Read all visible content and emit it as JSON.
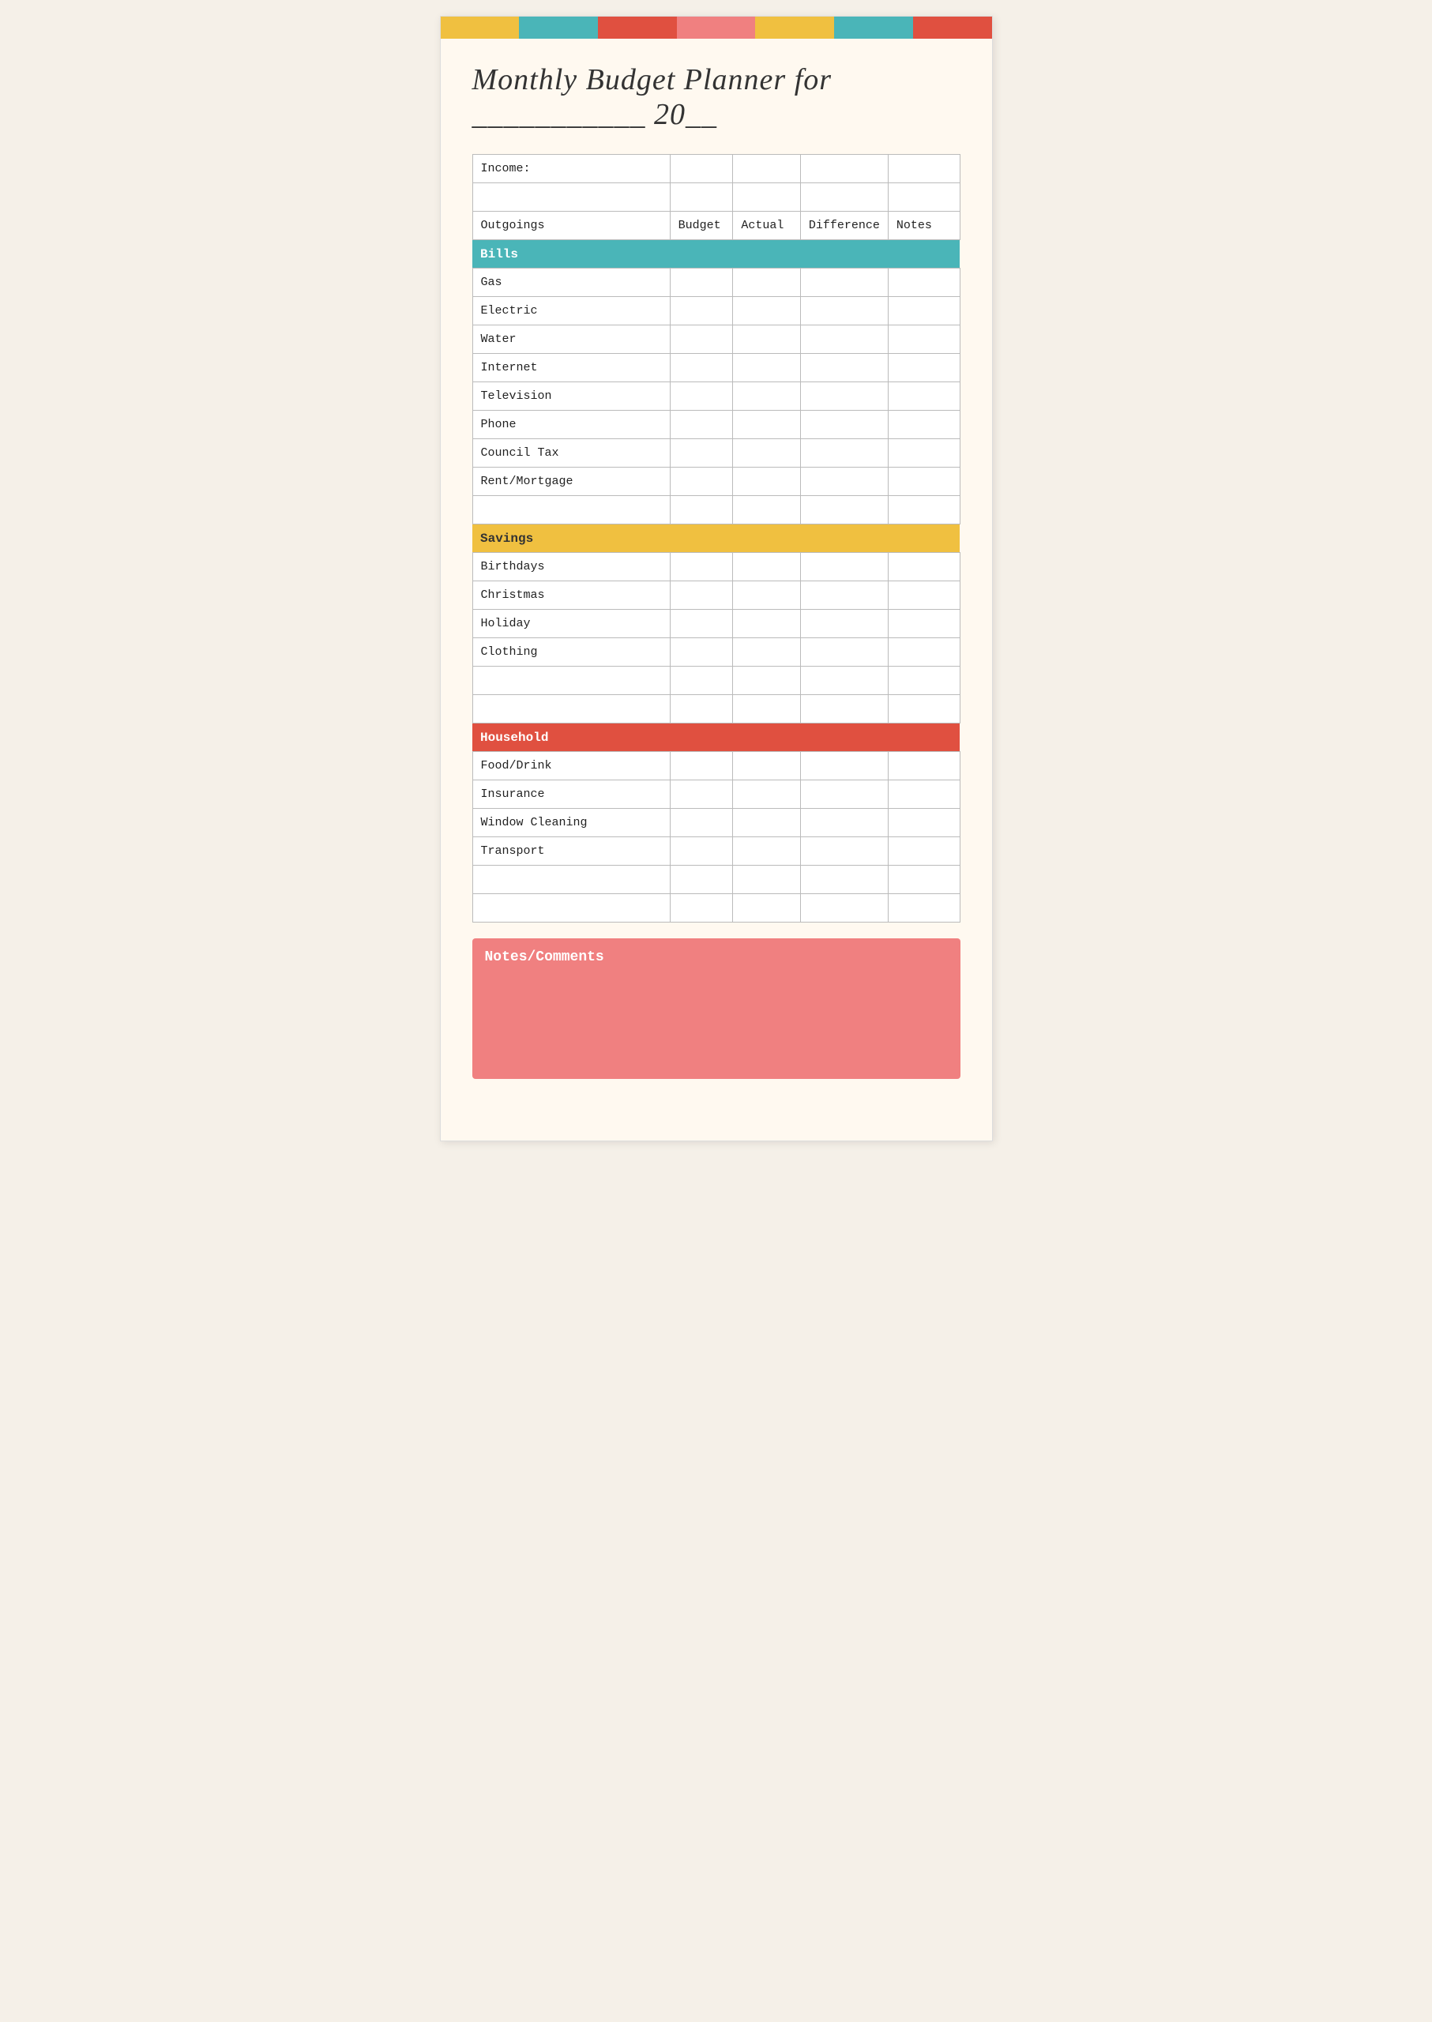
{
  "page": {
    "title_prefix": "Monthly Budget Planner for",
    "title_suffix": "20",
    "table": {
      "income_label": "Income:",
      "headers": {
        "outgoings": "Outgoings",
        "budget": "Budget",
        "actual": "Actual",
        "difference": "Difference",
        "notes": "Notes"
      },
      "sections": [
        {
          "id": "bills",
          "label": "Bills",
          "color_class": "cat-bills",
          "items": [
            "Gas",
            "Electric",
            "Water",
            "Internet",
            "Television",
            "Phone",
            "Council Tax",
            "Rent/Mortgage"
          ]
        },
        {
          "id": "savings",
          "label": "Savings",
          "color_class": "cat-savings",
          "items": [
            "Birthdays",
            "Christmas",
            "Holiday",
            "Clothing"
          ]
        },
        {
          "id": "household",
          "label": "Household",
          "color_class": "cat-household",
          "items": [
            "Food/Drink",
            "Insurance",
            "Window Cleaning",
            "Transport"
          ]
        }
      ]
    },
    "notes_section": {
      "label": "Notes/Comments"
    },
    "color_segments": [
      "seg-yellow",
      "seg-teal",
      "seg-red",
      "seg-pink",
      "seg-yellow2",
      "seg-teal2",
      "seg-red2"
    ]
  }
}
